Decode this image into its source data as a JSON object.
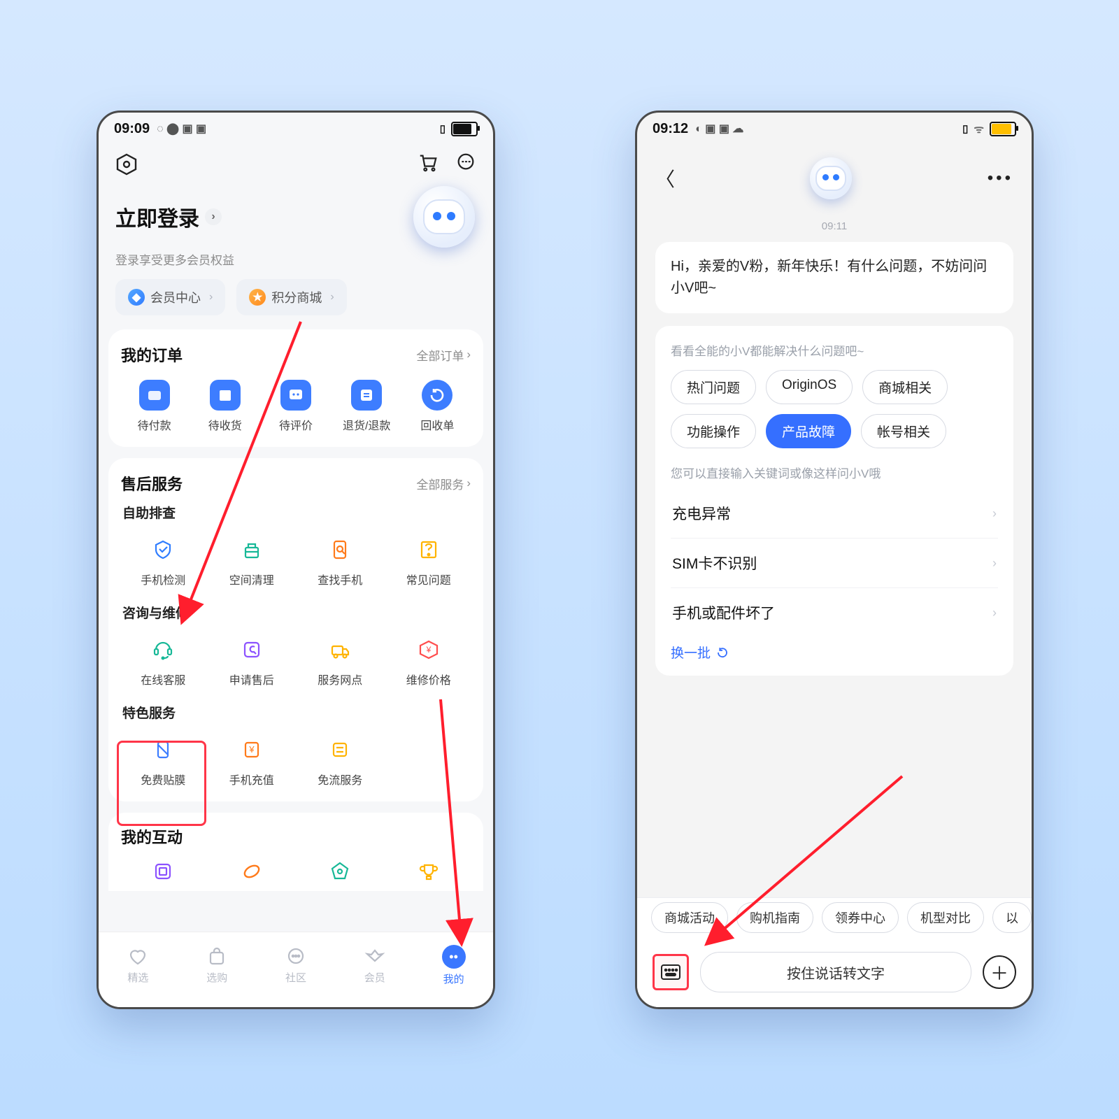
{
  "left": {
    "status_time": "09:09",
    "login_title": "立即登录",
    "login_sub": "登录享受更多会员权益",
    "pills": {
      "member": "会员中心",
      "points": "积分商城"
    },
    "orders": {
      "title": "我的订单",
      "more": "全部订单",
      "items": [
        "待付款",
        "待收货",
        "待评价",
        "退货/退款",
        "回收单"
      ]
    },
    "service": {
      "title": "售后服务",
      "more": "全部服务",
      "group1_title": "自助排查",
      "group1": [
        "手机检测",
        "空间清理",
        "查找手机",
        "常见问题"
      ],
      "group2_title": "咨询与维修",
      "group2": [
        "在线客服",
        "申请售后",
        "服务网点",
        "维修价格"
      ],
      "group3_title": "特色服务",
      "group3": [
        "免费贴膜",
        "手机充值",
        "免流服务"
      ]
    },
    "interact_title": "我的互动",
    "tabs": [
      "精选",
      "选购",
      "社区",
      "会员",
      "我的"
    ]
  },
  "right": {
    "status_time": "09:12",
    "time_mark": "09:11",
    "greeting": "Hi，亲爱的V粉，新年快乐！有什么问题，不妨问问小V吧~",
    "card_note": "看看全能的小V都能解决什么问题吧~",
    "chips": [
      "热门问题",
      "OriginOS",
      "商城相关",
      "功能操作",
      "产品故障",
      "帐号相关"
    ],
    "chip_selected": 4,
    "card_note2": "您可以直接输入关键词或像这样问小V哦",
    "questions": [
      "充电异常",
      "SIM卡不识别",
      "手机或配件坏了"
    ],
    "refresh": "换一批",
    "suggest": [
      "商城活动",
      "购机指南",
      "领券中心",
      "机型对比",
      "以"
    ],
    "talk": "按住说话转文字"
  }
}
